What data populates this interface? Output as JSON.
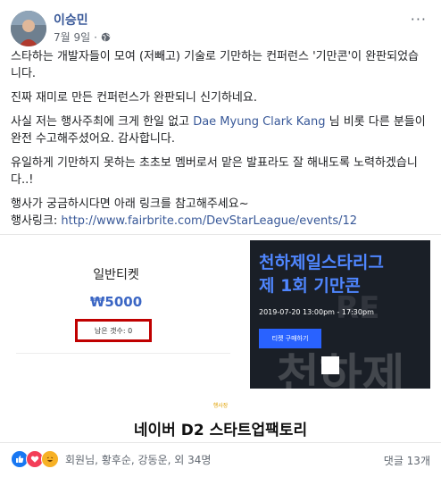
{
  "header": {
    "author": "이승민",
    "date": "7월 9일",
    "separator": "·",
    "more": "···"
  },
  "post": {
    "p1": "스타하는 개발자들이 모여 (저빼고) 기술로 기만하는 컨퍼런스 '기만콘'이 완판되었습니다.",
    "p2": "진짜 재미로 만든 컨퍼런스가 완판되니 신기하네요.",
    "p3_before": "사실 저는 행사주최에 크게 한일 없고 ",
    "p3_link": "Dae Myung Clark Kang",
    "p3_after": " 님 비롯 다른 분들이 완전 수고해주셨어요. 감사합니다.",
    "p4": "유일하게 기만하지 못하는 초초보 멤버로서 맡은 발표라도 잘 해내도록 노력하겠습니다..!",
    "p5_line1": "행사가 궁금하시다면 아래 링크를 참고해주세요~",
    "p5_prefix": "행사링크: ",
    "p5_link": "http://www.fairbrite.com/DevStarLeague/events/12"
  },
  "attachment": {
    "ticket_title": "일반티켓",
    "ticket_price": "₩5000",
    "remaining": "남은 갯수: 0",
    "banner_line1": "천하제일스타리그",
    "banner_line2": "제 1회 기만콘",
    "banner_date": "2019-07-20 13:00pm - 17:30pm",
    "banner_button": "티켓 구매하기",
    "banner_bg_text1": "RE",
    "banner_bg_text2": "천하제",
    "org_label": "행사장",
    "org_name": "네이버 D2 스타트업팩토리"
  },
  "footer": {
    "reactions_text": "회원님, 황후순, 강동운, 외 34명",
    "comments": "댓글 13개"
  },
  "colors": {
    "link": "#385898",
    "price": "#3b66c4",
    "highlight_border": "#c00000",
    "banner_title": "#4f86ff",
    "like": "#1877f2",
    "love": "#f33e58",
    "haha": "#f7b125"
  }
}
